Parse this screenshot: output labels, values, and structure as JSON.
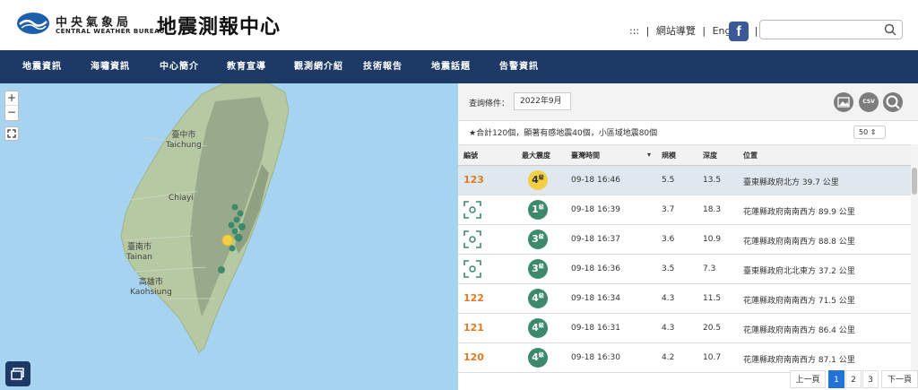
{
  "header": {
    "org_cn": "中央氣象局",
    "org_en": "CENTRAL WEATHER BUREAU",
    "site_title": "地震測報中心",
    "sitemap_glyph": ":::",
    "sitemap_label": "網站導覽",
    "english_label": "English",
    "facebook_glyph": "f",
    "search_placeholder": ""
  },
  "nav": {
    "items": [
      "地震資訊",
      "海嘯資訊",
      "中心簡介",
      "教育宣導",
      "觀測網介紹",
      "技術報告",
      "地震話題",
      "告警資訊"
    ]
  },
  "map": {
    "zoom_in": "+",
    "zoom_out": "−",
    "labels": {
      "taichung_cn": "臺中市",
      "taichung_en": "Taichung",
      "chiayi_en": "Chiayi",
      "tainan_cn": "臺南市",
      "tainan_en": "Tainan",
      "kaohsiung_cn": "高雄市",
      "kaohsiung_en": "Kaohsiung"
    },
    "colors": {
      "sea": "#a6d4f0",
      "land": "#b7c9a2",
      "mountain": "#8f9f84",
      "quake": "#3c8a6b",
      "highlight": "#f2cf44"
    }
  },
  "panel": {
    "query_label": "查詢條件：",
    "query_value": "2022年9月",
    "image_button": "image-icon",
    "csv_label": "CSV",
    "search_button": "search-icon",
    "summary": "合計120個，顯著有感地震40個，小區域地震80個",
    "page_size": "50 ⇕"
  },
  "table": {
    "headers": {
      "id": "編號",
      "intensity": "最大震度",
      "time": "臺灣時間",
      "magnitude": "規模",
      "depth": "深度",
      "location": "位置"
    },
    "sort_indicator": "▾",
    "rows": [
      {
        "id": "123",
        "intensity": "4",
        "unit": "級",
        "time": "09-18 16:46",
        "magnitude": "5.5",
        "depth": "13.5",
        "location": "臺東縣政府北方 39.7 公里"
      },
      {
        "id": "",
        "intensity": "1",
        "unit": "級",
        "time": "09-18 16:39",
        "magnitude": "3.7",
        "depth": "18.3",
        "location": "花蓮縣政府南南西方 89.9 公里"
      },
      {
        "id": "",
        "intensity": "3",
        "unit": "級",
        "time": "09-18 16:37",
        "magnitude": "3.6",
        "depth": "10.9",
        "location": "花蓮縣政府南南西方 88.8 公里"
      },
      {
        "id": "",
        "intensity": "3",
        "unit": "級",
        "time": "09-18 16:36",
        "magnitude": "3.5",
        "depth": "7.3",
        "location": "臺東縣政府北北東方 37.2 公里"
      },
      {
        "id": "122",
        "intensity": "4",
        "unit": "級",
        "time": "09-18 16:34",
        "magnitude": "4.3",
        "depth": "11.5",
        "location": "花蓮縣政府南南西方 71.5 公里"
      },
      {
        "id": "121",
        "intensity": "4",
        "unit": "級",
        "time": "09-18 16:31",
        "magnitude": "4.3",
        "depth": "20.5",
        "location": "花蓮縣政府南南西方 86.4 公里"
      },
      {
        "id": "120",
        "intensity": "4",
        "unit": "級",
        "time": "09-18 16:30",
        "magnitude": "4.2",
        "depth": "10.7",
        "location": "花蓮縣政府南南西方 87.1 公里"
      }
    ]
  },
  "pager": {
    "prev": "上一頁",
    "pages": [
      "1",
      "2",
      "3"
    ],
    "current": "1",
    "next": "下一頁"
  }
}
